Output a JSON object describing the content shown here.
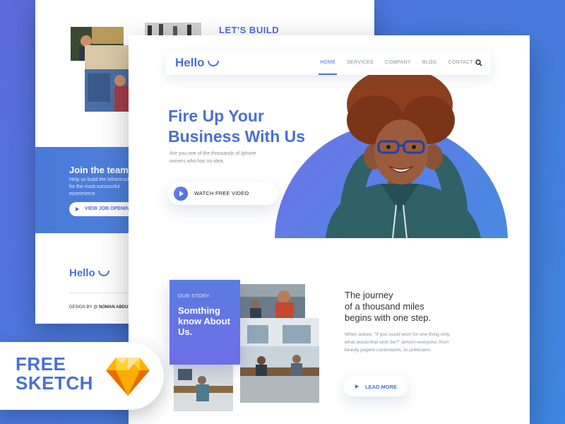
{
  "back_page": {
    "title": "LET'S BUILD",
    "join_title": "Join the team",
    "join_text": "Help us build the infrastructure for the most successful ecommerce",
    "job_button": "VIEW JOB OPENINGS",
    "logo": "Hello",
    "credit_prefix": "DESIGN BY @",
    "credit_name": "NOMAN ABDULLAH"
  },
  "main_page": {
    "logo": "Hello",
    "nav": [
      {
        "label": "HOME",
        "active": true
      },
      {
        "label": "SERVICES",
        "active": false
      },
      {
        "label": "COMPANY",
        "active": false
      },
      {
        "label": "BLOG",
        "active": false
      },
      {
        "label": "CONTACT",
        "active": false
      }
    ],
    "search_icon": "search-icon",
    "hero": {
      "title_line1": "Fire Up Your",
      "title_line2": "Business With Us",
      "subtitle": "Are you one of the thousands of Iphone owners who has no idea.",
      "video_button": "WATCH FREE VIDEO"
    },
    "story": {
      "kicker": "OUR STORY",
      "title": "Somthing know About Us."
    },
    "journey": {
      "title_line1": "The journey",
      "title_line2": "of a thousand miles",
      "title_line3": "begins with one step.",
      "text": "When asked, \"If you could wish for one thing only, what would that wish be?\" almost everyone; from beauty pagent contestants, to politicians.",
      "button": "LEAD MORE"
    }
  },
  "badge": {
    "line1": "FREE",
    "line2": "SKETCH"
  },
  "colors": {
    "accent": "#4a6fd6",
    "background_start": "#5b6bd8",
    "background_end": "#3f86e0",
    "sketch_orange": "#f6a821"
  }
}
